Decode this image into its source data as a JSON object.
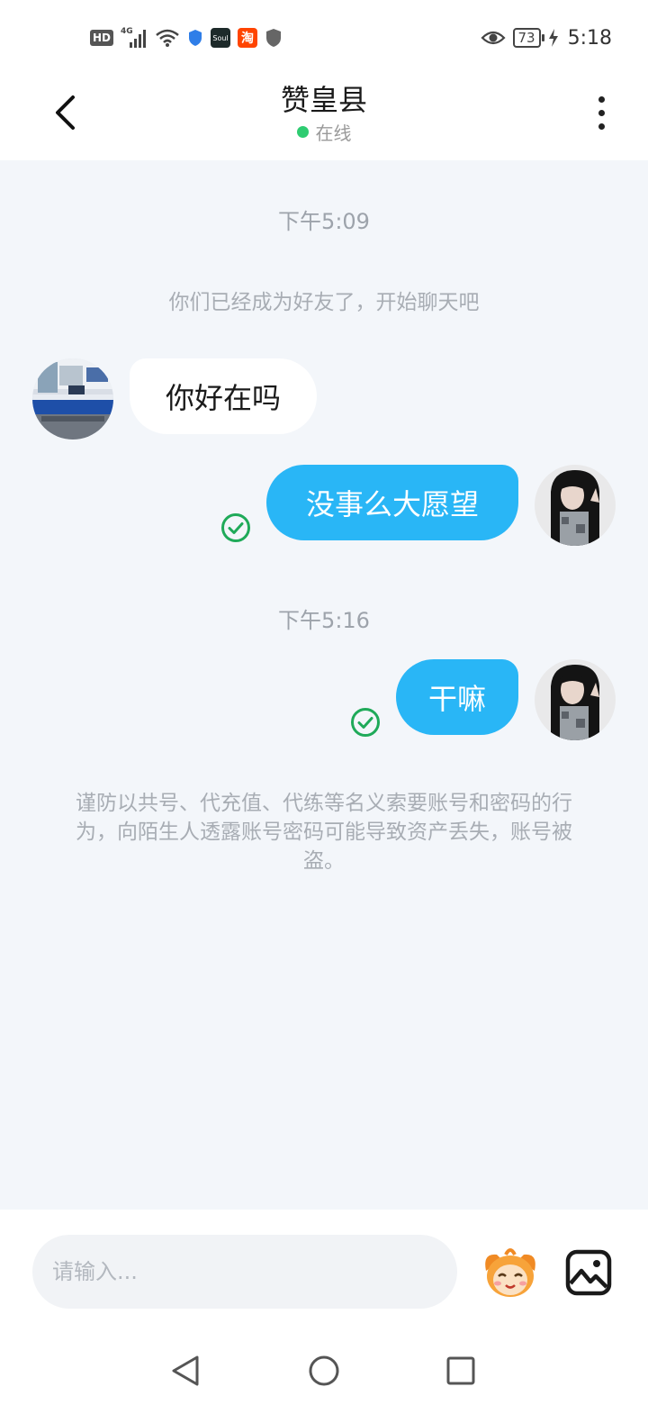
{
  "status_bar": {
    "network": "4G",
    "hd_badge": "HD",
    "soul_app": "Soul",
    "taobao_app": "淘",
    "battery": "73",
    "time": "5:18"
  },
  "header": {
    "title": "赞皇县",
    "status": "在线",
    "status_color": "#2ecc71"
  },
  "chat": {
    "time_1": "下午5:09",
    "system_msg": "你们已经成为好友了，开始聊天吧",
    "messages": [
      {
        "side": "in",
        "text": "你好在吗"
      },
      {
        "side": "out",
        "text": "没事么大愿望",
        "status": "read"
      },
      {
        "side": "out",
        "text": "干嘛",
        "status": "read"
      }
    ],
    "time_2": "下午5:16",
    "warning": "谨防以共号、代充值、代练等名义索要账号和密码的行为，向陌生人透露账号密码可能导致资产丢失，账号被盗。"
  },
  "input": {
    "placeholder": "请输入..."
  },
  "colors": {
    "accent": "#29b6f6",
    "chat_bg": "#f3f6fa",
    "read_check": "#1faa59"
  }
}
